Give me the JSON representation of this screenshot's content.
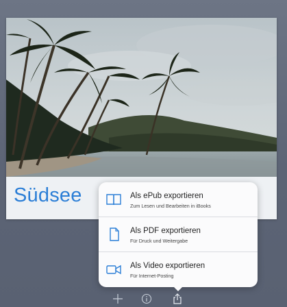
{
  "document": {
    "title": "Südsee"
  },
  "export_menu": {
    "items": [
      {
        "label": "Als ePub exportieren",
        "sublabel": "Zum Lesen und Bearbeiten in iBooks",
        "icon": "book-icon"
      },
      {
        "label": "Als PDF exportieren",
        "sublabel": "Für Druck und Weitergabe",
        "icon": "document-icon"
      },
      {
        "label": "Als Video exportieren",
        "sublabel": "Für Internet-Posting",
        "icon": "video-camera-icon"
      }
    ]
  },
  "toolbar": {
    "icons": [
      "plus-icon",
      "info-icon",
      "share-icon"
    ]
  },
  "colors": {
    "accent": "#2b7ed6",
    "background": "#5f6878",
    "popover": "#fbfbfc"
  }
}
